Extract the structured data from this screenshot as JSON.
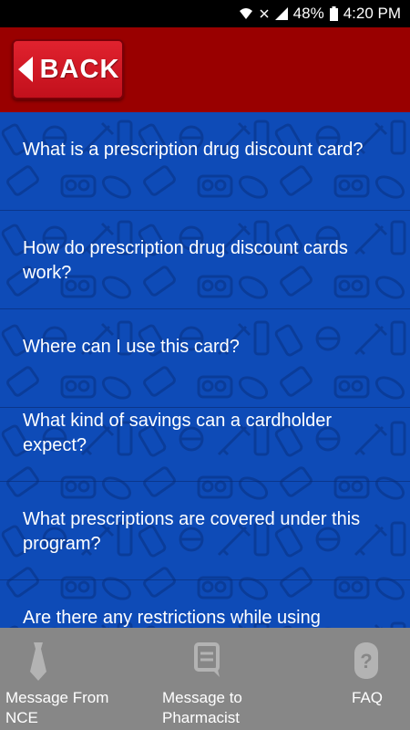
{
  "status_bar": {
    "battery": "48%",
    "time": "4:20 PM"
  },
  "header": {
    "back_label": "BACK"
  },
  "faq_list": {
    "items": [
      {
        "question": "What is a prescription drug discount card?"
      },
      {
        "question": "How do prescription drug discount cards work?"
      },
      {
        "question": "Where can I use this card?"
      },
      {
        "question": "What kind of savings can a cardholder expect?"
      },
      {
        "question": "What prescriptions are covered under this program?"
      },
      {
        "question": "Are there any restrictions while using"
      }
    ]
  },
  "bottom_nav": {
    "message_from_nce": "Message From NCE",
    "message_to_pharmacist": "Message to Pharmacist",
    "faq": "FAQ"
  },
  "colors": {
    "header": "#990000",
    "list_background": "#0e4bb7",
    "bottom_bar": "#878787",
    "back_button": "#d2141f"
  }
}
